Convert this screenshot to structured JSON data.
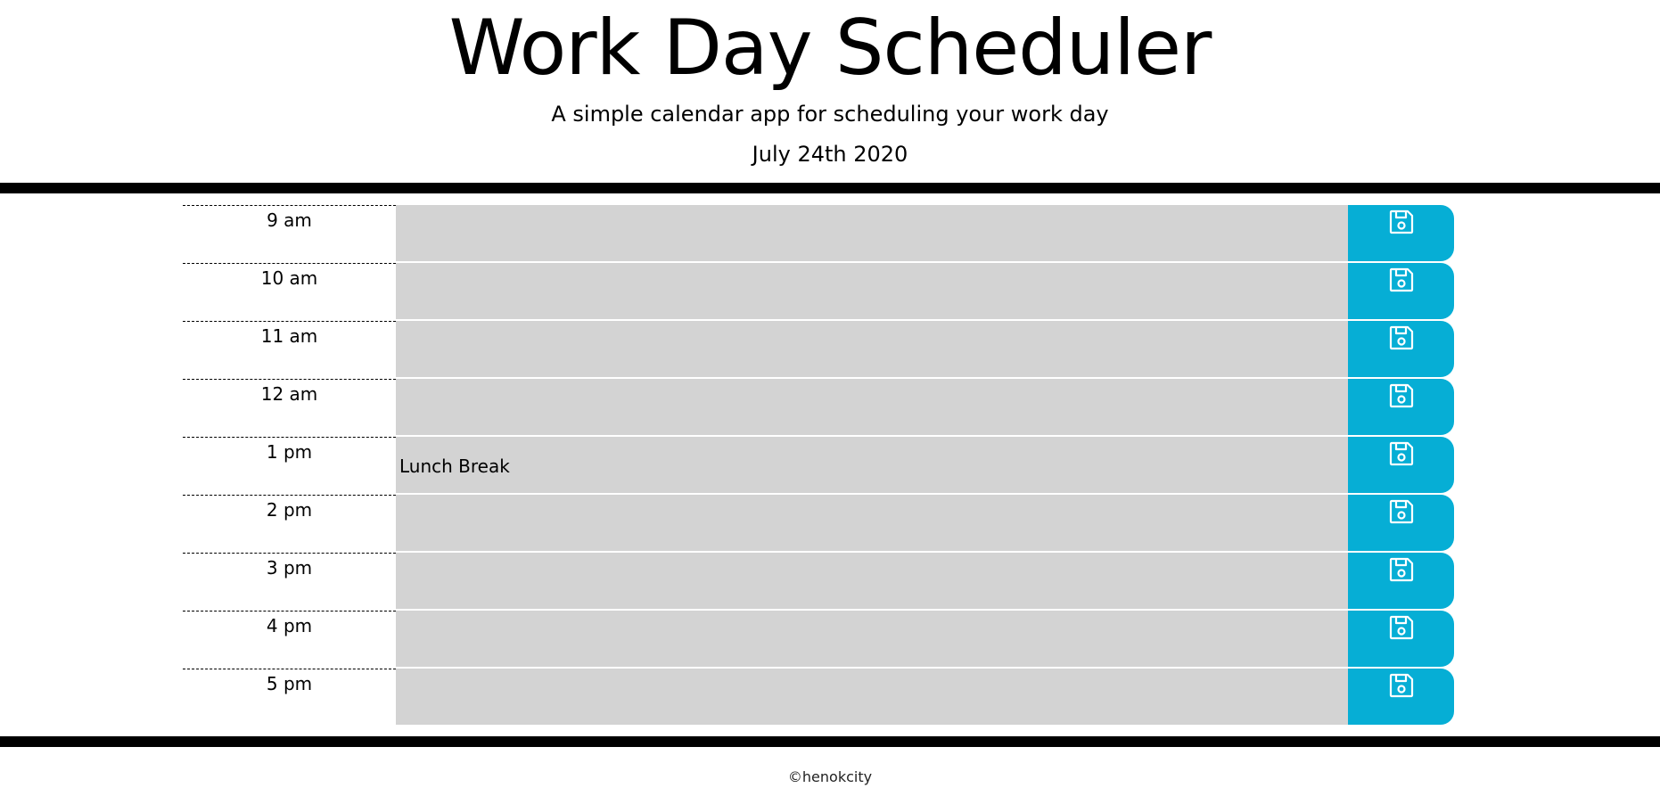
{
  "header": {
    "title": "Work Day Scheduler",
    "subtitle": "A simple calendar app for scheduling your work day",
    "current_date": "July 24th 2020"
  },
  "colors": {
    "save_button": "#06aed5",
    "time_block": "#d3d3d3",
    "divider": "#000000"
  },
  "time_blocks": [
    {
      "hour": "9 am",
      "description": ""
    },
    {
      "hour": "10 am",
      "description": ""
    },
    {
      "hour": "11 am",
      "description": ""
    },
    {
      "hour": "12 am",
      "description": ""
    },
    {
      "hour": "1 pm",
      "description": "Lunch Break"
    },
    {
      "hour": "2 pm",
      "description": ""
    },
    {
      "hour": "3 pm",
      "description": ""
    },
    {
      "hour": "4 pm",
      "description": ""
    },
    {
      "hour": "5 pm",
      "description": ""
    }
  ],
  "save_icon": "floppy-disk-icon",
  "footer": {
    "credit": "©henokcity"
  }
}
